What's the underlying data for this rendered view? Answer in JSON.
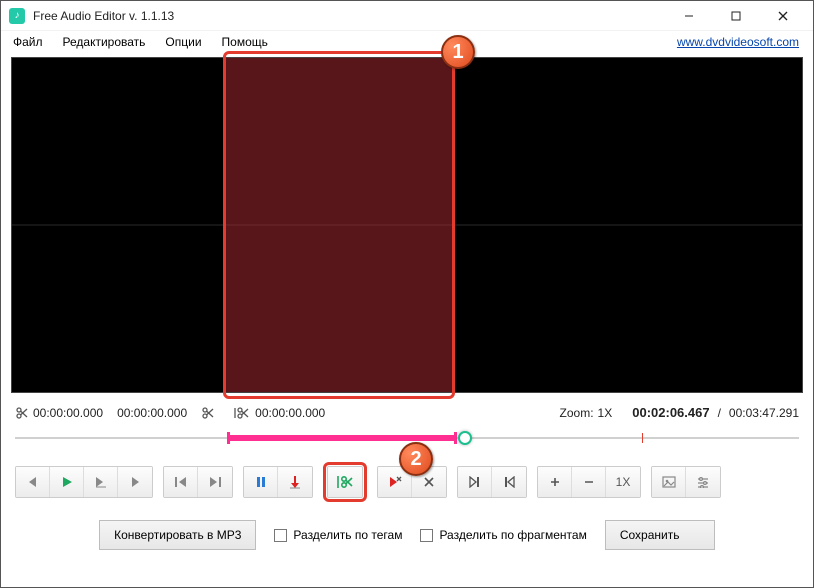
{
  "titlebar": {
    "app_title": "Free Audio Editor v. 1.1.13"
  },
  "menubar": {
    "file": "Файл",
    "edit": "Редактировать",
    "options": "Опции",
    "help": "Помощь",
    "site_link": "www.dvdvideosoft.com"
  },
  "info": {
    "sel_start": "00:00:00.000",
    "sel_end": "00:00:00.000",
    "cut_time": "00:00:00.000",
    "zoom_label": "Zoom:",
    "zoom_value": "1X",
    "current_time": "00:02:06.467",
    "slash": "/",
    "total_time": "00:03:47.291"
  },
  "controls": {
    "speed_label": "1X"
  },
  "bottom": {
    "convert_mp3": "Конвертировать в MP3",
    "split_by_tags": "Разделить по тегам",
    "split_by_fragments": "Разделить по фрагментам",
    "save": "Сохранить"
  },
  "annotations": {
    "one": "1",
    "two": "2"
  }
}
